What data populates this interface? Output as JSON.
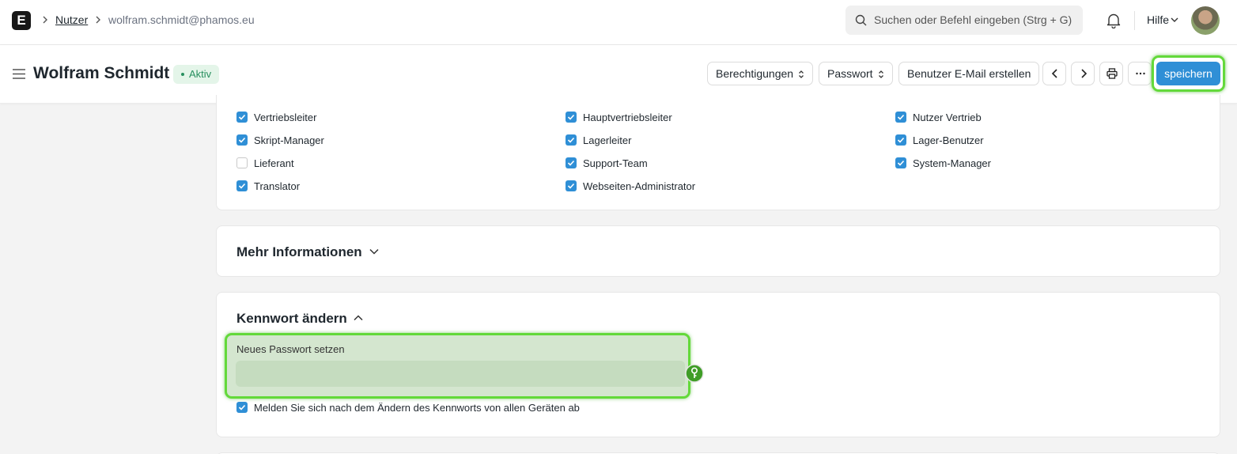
{
  "app": {
    "logo_letter": "E"
  },
  "breadcrumb": {
    "parent": "Nutzer",
    "current": "wolfram.schmidt@phamos.eu"
  },
  "search": {
    "placeholder": "Suchen oder Befehl eingeben (Strg + G)"
  },
  "navbar": {
    "help_label": "Hilfe"
  },
  "header": {
    "title": "Wolfram Schmidt",
    "status": "Aktiv",
    "buttons": {
      "permissions": "Berechtigungen",
      "password": "Passwort",
      "create_email": "Benutzer E-Mail erstellen",
      "save": "speichern"
    }
  },
  "roles": [
    {
      "label": "Vertriebsleiter",
      "checked": true
    },
    {
      "label": "Hauptvertriebsleiter",
      "checked": true
    },
    {
      "label": "Nutzer Vertrieb",
      "checked": true
    },
    {
      "label": "Skript-Manager",
      "checked": true
    },
    {
      "label": "Lagerleiter",
      "checked": true
    },
    {
      "label": "Lager-Benutzer",
      "checked": true
    },
    {
      "label": "Lieferant",
      "checked": false
    },
    {
      "label": "Support-Team",
      "checked": true
    },
    {
      "label": "System-Manager",
      "checked": true
    },
    {
      "label": "Translator",
      "checked": true
    },
    {
      "label": "Webseiten-Administrator",
      "checked": true
    }
  ],
  "sections": {
    "more_info": {
      "title": "Mehr Informationen",
      "expanded": false
    },
    "change_password": {
      "title": "Kennwort ändern",
      "expanded": true,
      "new_password_label": "Neues Passwort setzen",
      "new_password_value": "",
      "logout_all_label": "Melden Sie sich nach dem Ändern des Kennworts von allen Geräten ab",
      "logout_all_checked": true
    }
  },
  "colors": {
    "primary": "#2f8fd6",
    "status_green": "#278f5e",
    "highlight": "#63d93a"
  }
}
